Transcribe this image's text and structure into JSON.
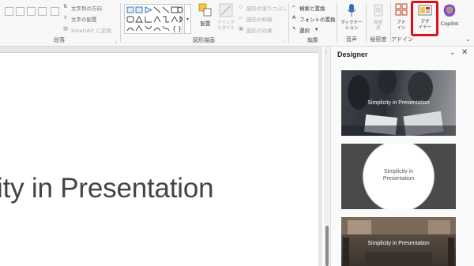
{
  "ribbon": {
    "paragraph": {
      "label": "段落",
      "text_direction": "文字列の方向",
      "align_text": "文字の配置",
      "smartart": "SmartArt に変換"
    },
    "drawing": {
      "label": "図形描画",
      "arrange": "配置",
      "quick_styles": "クイック\nスタイル",
      "shape_fill": "図形の塗りつぶし",
      "shape_outline": "図形の枠線",
      "shape_effects": "図形の効果"
    },
    "editing": {
      "label": "編集",
      "find_replace": "検索と置換",
      "replace_fonts": "フォントの置換",
      "select": "選択"
    },
    "voice": {
      "label": "音声",
      "dictate": "ディクテー\nション"
    },
    "sensitivity": {
      "label": "秘密度",
      "button": "秘密\n度"
    },
    "addins": {
      "label": "アドイン",
      "button": "アド\nイン"
    },
    "designer_button": "デザ\nイナー",
    "copilot_button": "Copilot"
  },
  "slide": {
    "title_fragment": "ity in Presentation"
  },
  "designer_pane": {
    "title": "Designer",
    "cards": [
      {
        "text": "Simplicity in Presentation"
      },
      {
        "text": "Simplicity in\nPresentation"
      },
      {
        "text": "Simplicity in Presentation"
      }
    ]
  },
  "colors": {
    "highlight": "#e0101a",
    "accent": "#c43e1c"
  }
}
